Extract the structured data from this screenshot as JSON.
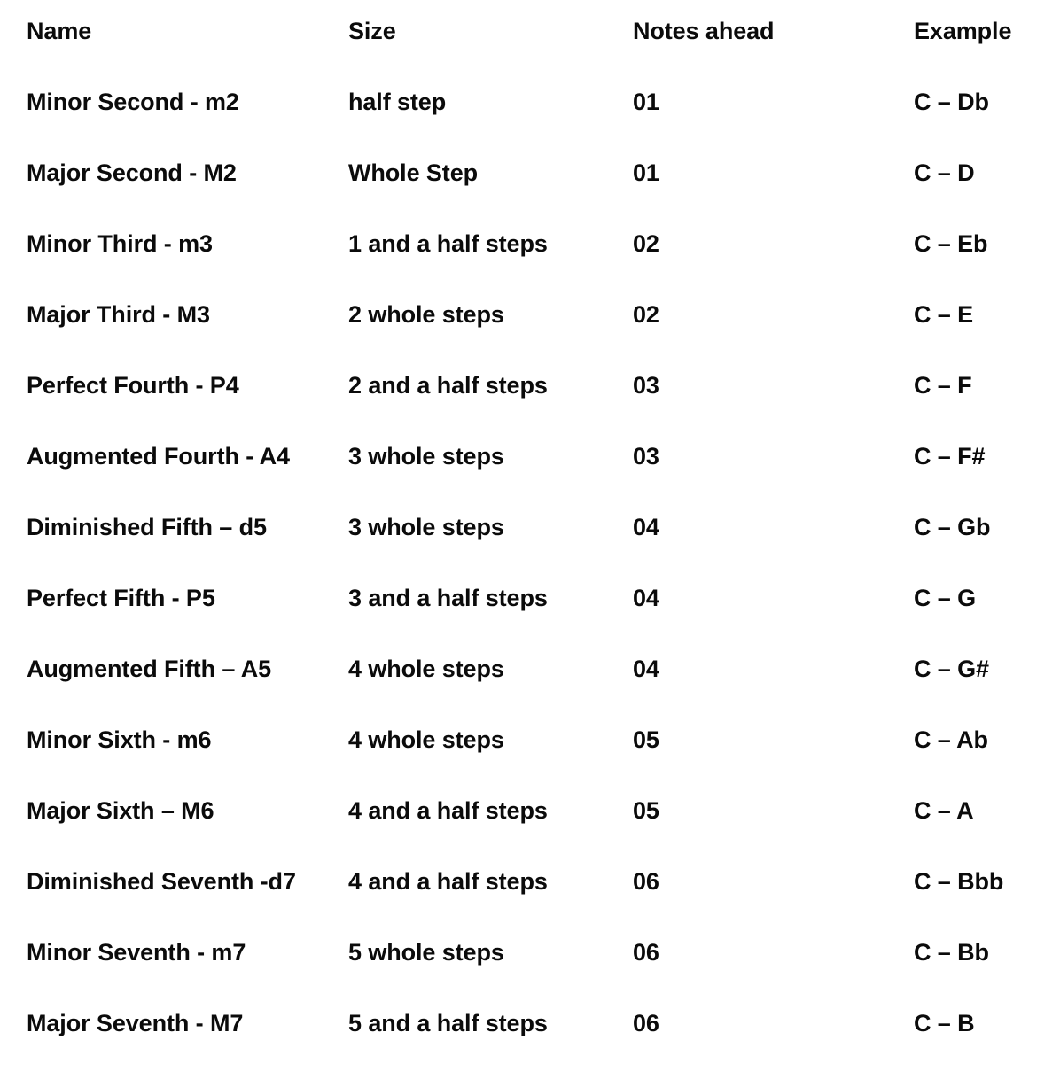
{
  "table": {
    "columns": [
      "Name",
      "Size",
      "Notes ahead",
      "Example"
    ],
    "rows": [
      {
        "name": "Minor Second - m2",
        "size": "half step",
        "notes_ahead": "01",
        "example": "C – Db"
      },
      {
        "name": "Major Second - M2",
        "size": "Whole Step",
        "notes_ahead": "01",
        "example": "C – D"
      },
      {
        "name": "Minor Third - m3",
        "size": "1 and a half steps",
        "notes_ahead": "02",
        "example": "C – Eb"
      },
      {
        "name": "Major Third - M3",
        "size": "2 whole steps",
        "notes_ahead": "02",
        "example": "C – E"
      },
      {
        "name": "Perfect Fourth - P4",
        "size": "2 and a half steps",
        "notes_ahead": "03",
        "example": "C – F"
      },
      {
        "name": "Augmented Fourth - A4",
        "size": "3 whole steps",
        "notes_ahead": "03",
        "example": "C – F#"
      },
      {
        "name": "Diminished Fifth – d5",
        "size": "3 whole steps",
        "notes_ahead": "04",
        "example": "C – Gb"
      },
      {
        "name": "Perfect Fifth - P5",
        "size": "3 and a half steps",
        "notes_ahead": "04",
        "example": "C – G"
      },
      {
        "name": "Augmented Fifth – A5",
        "size": "4 whole steps",
        "notes_ahead": "04",
        "example": "C – G#"
      },
      {
        "name": "Minor Sixth - m6",
        "size": "4 whole steps",
        "notes_ahead": "05",
        "example": "C – Ab"
      },
      {
        "name": "Major Sixth – M6",
        "size": "4 and a half steps",
        "notes_ahead": "05",
        "example": "C – A"
      },
      {
        "name": "Diminished Seventh -d7",
        "size": "4 and a half steps",
        "notes_ahead": "06",
        "example": "C – Bbb"
      },
      {
        "name": "Minor Seventh - m7",
        "size": "5 whole steps",
        "notes_ahead": "06",
        "example": "C – Bb"
      },
      {
        "name": "Major Seventh - M7",
        "size": "5 and a half steps",
        "notes_ahead": "06",
        "example": "C – B"
      }
    ]
  },
  "colors": {
    "background": "#ffffff",
    "text": "#0b0b0b"
  }
}
